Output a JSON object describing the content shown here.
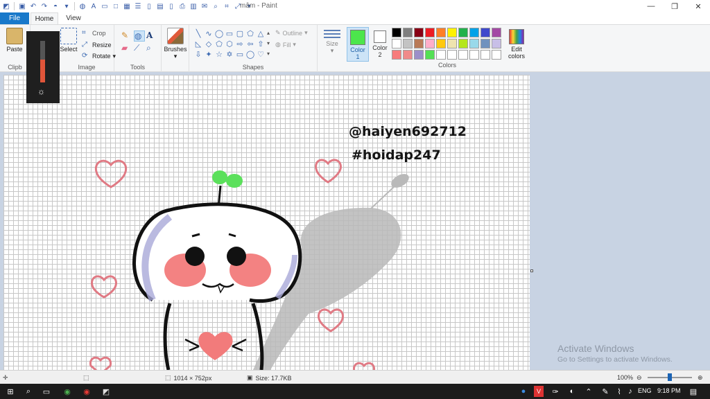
{
  "window": {
    "title": "mâm - Paint",
    "minimize": "—",
    "maximize": "❐",
    "close": "✕"
  },
  "tabs": {
    "file": "File",
    "home": "Home",
    "view": "View"
  },
  "ribbon": {
    "clipboard": {
      "paste": "Paste",
      "group": "Clipb"
    },
    "image": {
      "select": "Select",
      "crop": "Crop",
      "resize": "Resize",
      "rotate": "Rotate",
      "group": "Image"
    },
    "tools": {
      "group": "Tools"
    },
    "brushes": {
      "label": "Brushes"
    },
    "shapes": {
      "outline": "Outline",
      "fill": "Fill",
      "group": "Shapes"
    },
    "size": {
      "label": "Size"
    },
    "color1": {
      "label": "Color",
      "num": "1",
      "color": "#4ce64c"
    },
    "color2": {
      "label": "Color",
      "num": "2",
      "color": "#ffffff"
    },
    "colors": {
      "group": "Colors",
      "edit_line1": "Edit",
      "edit_line2": "colors",
      "palette": [
        "#000000",
        "#7f7f7f",
        "#880015",
        "#ed1c24",
        "#ff7f27",
        "#fff200",
        "#22b14c",
        "#00a2e8",
        "#3f48cc",
        "#a349a4",
        "#ffffff",
        "#c3c3c3",
        "#b97a57",
        "#ffaec9",
        "#ffc90e",
        "#efe4b0",
        "#b5e61d",
        "#99d9ea",
        "#7092be",
        "#c8bfe7",
        "#f77c7c",
        "#f08a8a",
        "#9b8fc9",
        "#54e054",
        "#ffffff",
        "#ffffff",
        "#ffffff",
        "#ffffff",
        "#ffffff",
        "#ffffff"
      ]
    }
  },
  "canvas": {
    "handle1": "@haiyen692712",
    "handle2": "#hoidap247"
  },
  "volume": {
    "level": 0.55
  },
  "activation": {
    "title": "Activate Windows",
    "subtitle": "Go to Settings to activate Windows."
  },
  "status": {
    "dimensions": "1014 × 752px",
    "size": "Size: 17.7KB",
    "zoom": "100%",
    "zoom_level": 0.5
  },
  "taskbar": {
    "lang": "ENG",
    "time": "9:18 PM"
  }
}
